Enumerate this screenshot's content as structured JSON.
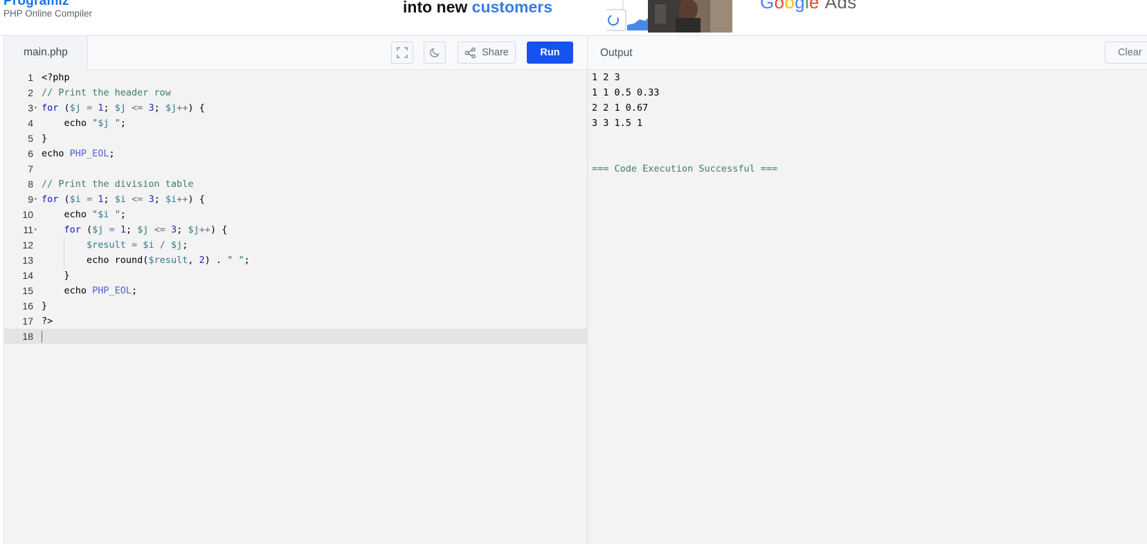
{
  "header": {
    "brand": "Programiz",
    "subtitle": "PHP Online Compiler",
    "ad": {
      "line_plain": "into new ",
      "line_highlight": "customers",
      "google_letters": [
        "G",
        "o",
        "o",
        "g",
        "l",
        "e"
      ],
      "google_ads": "Ads"
    }
  },
  "editor": {
    "file_tab": "main.php",
    "share_label": "Share",
    "run_label": "Run",
    "lines": [
      "<?php",
      "// Print the header row",
      "for ($j = 1; $j <= 3; $j++) {",
      "    echo \"$j \";",
      "}",
      "echo PHP_EOL;",
      "",
      "// Print the division table",
      "for ($i = 1; $i <= 3; $i++) {",
      "    echo \"$i \";",
      "    for ($j = 1; $j <= 3; $j++) {",
      "        $result = $i / $j;",
      "        echo round($result, 2) . \" \";",
      "    }",
      "    echo PHP_EOL;",
      "}",
      "?>",
      ""
    ],
    "line_numbers": [
      "1",
      "2",
      "3",
      "4",
      "5",
      "6",
      "7",
      "8",
      "9",
      "10",
      "11",
      "12",
      "13",
      "14",
      "15",
      "16",
      "17",
      "18"
    ],
    "fold_lines": [
      3,
      9,
      11
    ],
    "active_line": 18
  },
  "output": {
    "title": "Output",
    "clear_label": "Clear",
    "lines": [
      "1 2 3",
      "1 1 0.5 0.33",
      "2 2 1 0.67",
      "3 3 1.5 1",
      "",
      "",
      "=== Code Execution Successful ==="
    ]
  },
  "colors": {
    "run_button": "#1652f0",
    "keyword": "#0a14c8",
    "variable": "#317b8a",
    "comment": "#3b7b6c",
    "constant": "#5560d6"
  }
}
